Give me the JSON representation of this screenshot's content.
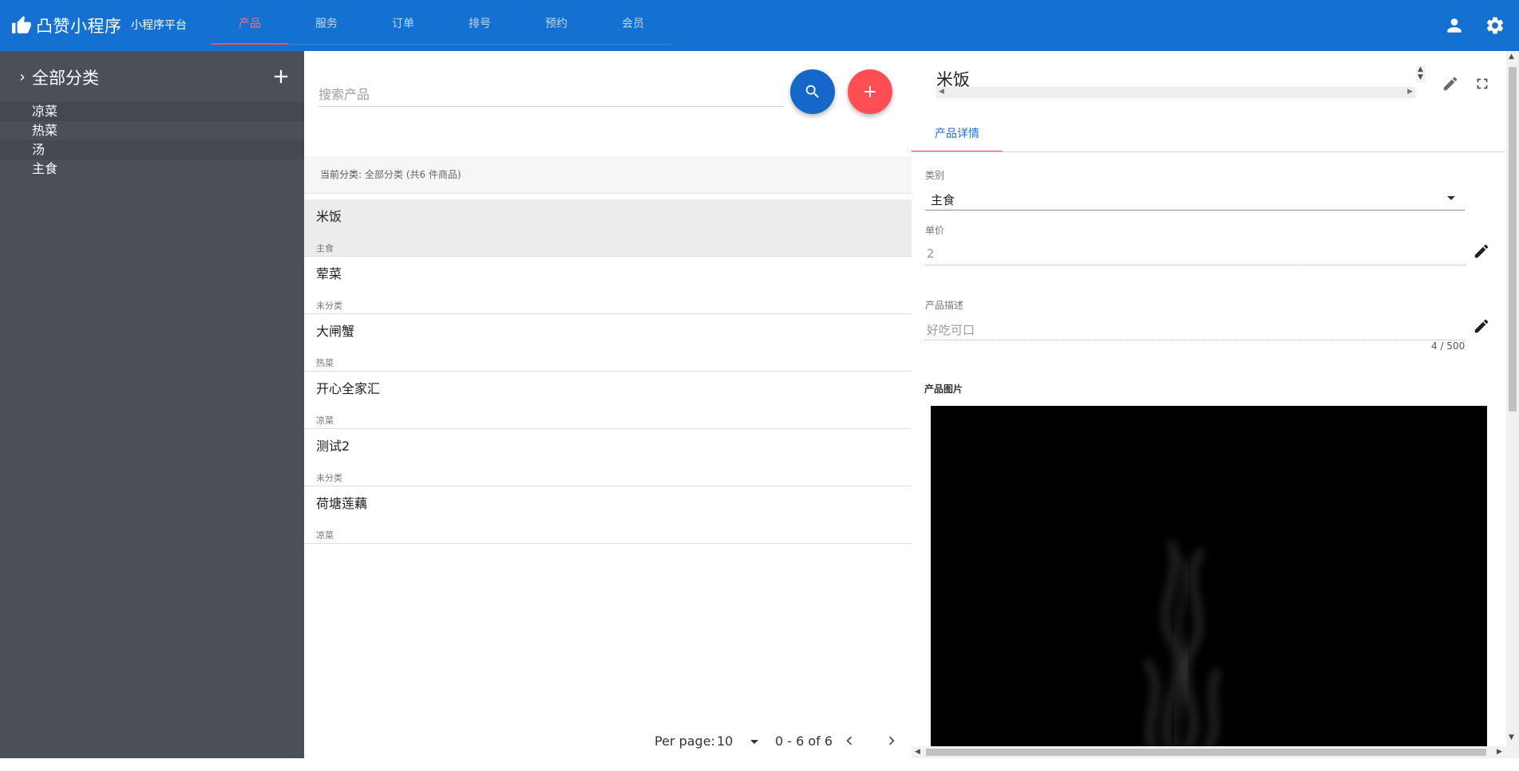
{
  "app": {
    "title": "凸赞小程序",
    "subtitle": "小程序平台",
    "accent_color": "#1471d1",
    "active_color": "#ff5252"
  },
  "nav": {
    "tabs": [
      {
        "label": "产品",
        "active": true
      },
      {
        "label": "服务",
        "active": false
      },
      {
        "label": "订单",
        "active": false
      },
      {
        "label": "排号",
        "active": false
      },
      {
        "label": "预约",
        "active": false
      },
      {
        "label": "会员",
        "active": false
      }
    ]
  },
  "topbar_icons": [
    "account-icon",
    "settings-icon"
  ],
  "sidebar": {
    "title": "全部分类",
    "items": [
      {
        "label": "凉菜"
      },
      {
        "label": "热菜"
      },
      {
        "label": "汤"
      },
      {
        "label": "主食"
      }
    ]
  },
  "search": {
    "placeholder": "搜索产品",
    "value": ""
  },
  "category_bar": {
    "label": "当前分类:",
    "value": "全部分类 (共6 件商品)"
  },
  "products": [
    {
      "name": "米饭",
      "category": "主食",
      "selected": true
    },
    {
      "name": "荤菜",
      "category": "未分类",
      "selected": false
    },
    {
      "name": "大闸蟹",
      "category": "热菜",
      "selected": false
    },
    {
      "name": "开心全家汇",
      "category": "凉菜",
      "selected": false
    },
    {
      "name": "测试2",
      "category": "未分类",
      "selected": false
    },
    {
      "name": "荷塘莲藕",
      "category": "凉菜",
      "selected": false
    }
  ],
  "pager": {
    "per_page_label": "Per page:",
    "per_page_value": "10",
    "range": "0 - 6 of 6"
  },
  "detail": {
    "title": "米饭",
    "tab_label": "产品详情",
    "category_label": "类别",
    "category_value": "主食",
    "price_label": "单价",
    "price_value": "2",
    "description_label": "产品描述",
    "description_value": "好吃可口",
    "description_counter": "4 / 500",
    "image_label": "产品图片"
  }
}
